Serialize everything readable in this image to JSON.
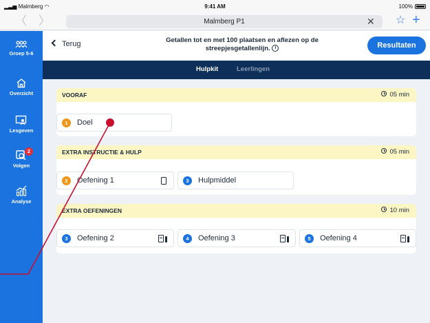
{
  "status_bar": {
    "carrier": "Malmberg",
    "time": "9:41 AM",
    "battery": "100%"
  },
  "browser": {
    "url": "Malmberg P1"
  },
  "sidebar": {
    "items": [
      {
        "label": "Groep 5-6",
        "icon": "group-icon"
      },
      {
        "label": "Overzicht",
        "icon": "home-icon"
      },
      {
        "label": "Lesgeven",
        "icon": "teach-board-icon"
      },
      {
        "label": "Volgen",
        "icon": "track-icon",
        "badge": "2"
      },
      {
        "label": "Analyse",
        "icon": "analysis-chart-icon"
      }
    ]
  },
  "header": {
    "back_label": "Terug",
    "title": "Getallen tot en met 100 plaatsen en aflezen op de streepjesgetallenlijn.",
    "info_icon": "info-icon",
    "results_label": "Resultaten"
  },
  "tabs": [
    {
      "label": "Hulpkit",
      "active": true
    },
    {
      "label": "Leerlingen",
      "active": false
    }
  ],
  "sections": [
    {
      "title": "VOORAF",
      "time": "05 min",
      "items": [
        {
          "number": "1",
          "label": "Doel",
          "color": "#f0961a",
          "icon": null
        }
      ]
    },
    {
      "title": "EXTRA INSTRUCTIE & HULP",
      "time": "05 min",
      "items": [
        {
          "number": "2",
          "label": "Oefening 1",
          "color": "#f0961a",
          "icon": "tablet-icon"
        },
        {
          "number": "3",
          "label": "Hulpmiddel",
          "color": "#1b73e0",
          "icon": null
        }
      ]
    },
    {
      "title": "EXTRA OEFENINGEN",
      "time": "10 min",
      "items": [
        {
          "number": "3",
          "label": "Oefening 2",
          "color": "#1b73e0",
          "icon": "workbook-icon"
        },
        {
          "number": "4",
          "label": "Oefening 3",
          "color": "#1b73e0",
          "icon": "workbook-icon"
        },
        {
          "number": "5",
          "label": "Oefening 4",
          "color": "#1b73e0",
          "icon": "workbook-icon"
        }
      ]
    }
  ],
  "colors": {
    "accent": "#1b73e0",
    "navy": "#0e2f5a",
    "section_header": "#fcf5c4",
    "orange": "#f0961a",
    "annotation": "#c8102e"
  }
}
